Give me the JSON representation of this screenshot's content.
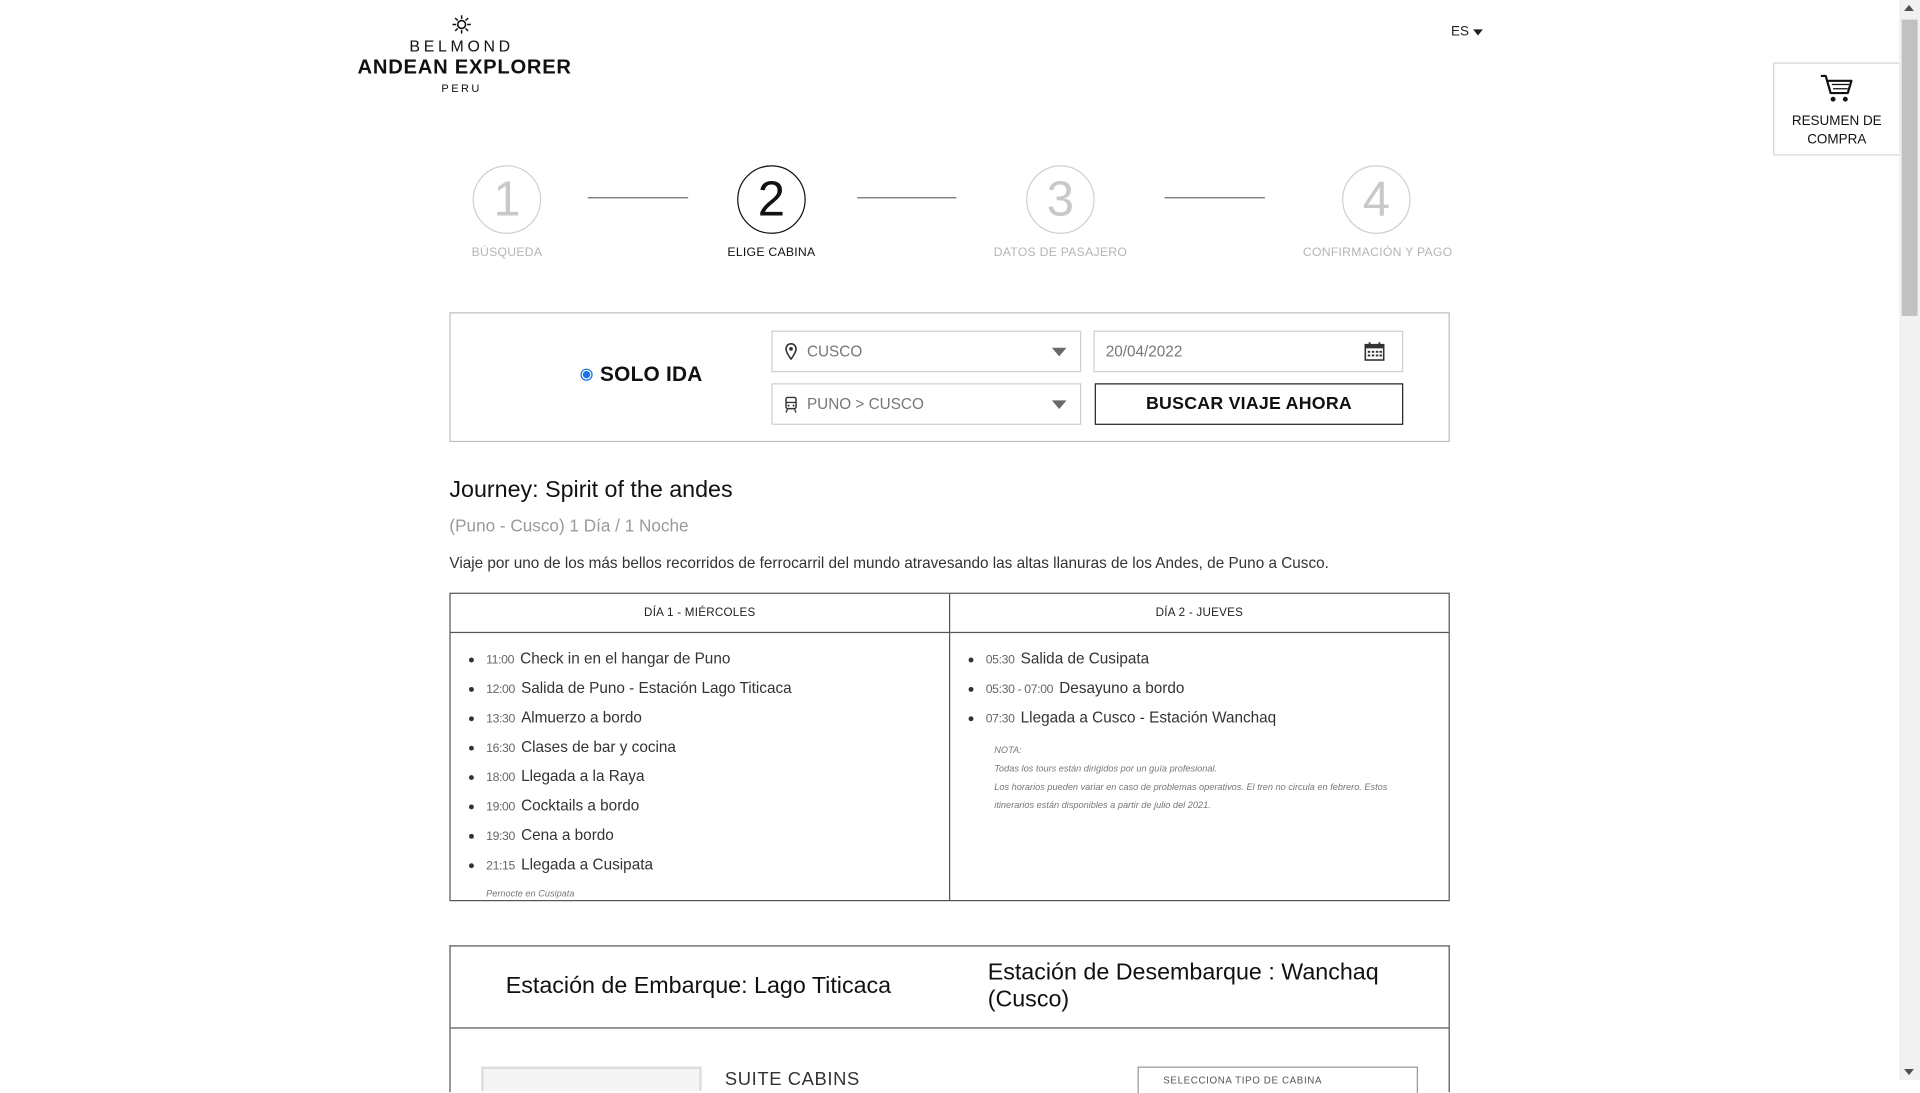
{
  "header": {
    "logo": {
      "brand": "BELMOND",
      "name": "ANDEAN EXPLORER",
      "country": "PERU"
    },
    "language": "ES",
    "cart_label": "RESUMEN DE COMPRA"
  },
  "steps": [
    {
      "number": "1",
      "label": "BÚSQUEDA",
      "state": "inactive"
    },
    {
      "number": "2",
      "label": "ELIGE CABINA",
      "state": "active"
    },
    {
      "number": "3",
      "label": "DATOS DE PASAJERO",
      "state": "inactive"
    },
    {
      "number": "4",
      "label": "CONFIRMACIÓN Y PAGO",
      "state": "inactive"
    }
  ],
  "search": {
    "trip_type_label": "SOLO IDA",
    "trip_type_selected": true,
    "origin": "CUSCO",
    "date": "20/04/2022",
    "route": "PUNO > CUSCO",
    "button_label": "BUSCAR VIAJE AHORA"
  },
  "journey": {
    "title": "Journey: Spirit of the andes",
    "subtitle": "(Puno - Cusco) 1 Día / 1 Noche",
    "description": "Viaje por uno de los más bellos recorridos de ferrocarril del mundo atravesando las altas llanuras de los Andes, de Puno a Cusco."
  },
  "itinerary": {
    "day1": {
      "header": "DÍA 1 - MIÉRCOLES",
      "items": [
        {
          "time": "11:00",
          "text": "Check in en el hangar de Puno"
        },
        {
          "time": "12:00",
          "text": "Salida de Puno - Estación Lago Titicaca"
        },
        {
          "time": "13:30",
          "text": "Almuerzo a bordo"
        },
        {
          "time": "16:30",
          "text": "Clases de bar y cocina"
        },
        {
          "time": "18:00",
          "text": "Llegada a la Raya"
        },
        {
          "time": "19:00",
          "text": "Cocktails a bordo"
        },
        {
          "time": "19:30",
          "text": "Cena a bordo"
        },
        {
          "time": "21:15",
          "text": "Llegada a Cusipata"
        }
      ],
      "footnote": "Pernocte en Cusipata"
    },
    "day2": {
      "header": "DÍA 2 - JUEVES",
      "items": [
        {
          "time": "05:30",
          "text": "Salida de Cusipata"
        },
        {
          "time": "05:30 - 07:00",
          "text": "Desayuno a bordo"
        },
        {
          "time": "07:30",
          "text": "Llegada a Cusco - Estación Wanchaq"
        }
      ],
      "note_title": "NOTA:",
      "note_line1": "Todas los tours están dirigidos por un guía profesional.",
      "note_line2": "Los horarios pueden variar en caso de problemas operativos. El tren no circula en febrero. Estos itinerarios están disponibles a partir de julio del 2021."
    }
  },
  "stations": {
    "boarding": "Estación de Embarque: Lago Titicaca",
    "disembark": "Estación de Desembarque : Wanchaq (Cusco)"
  },
  "cabin": {
    "title": "SUITE CABINS",
    "select_placeholder": "SELECCIONA TIPO DE CABINA"
  }
}
